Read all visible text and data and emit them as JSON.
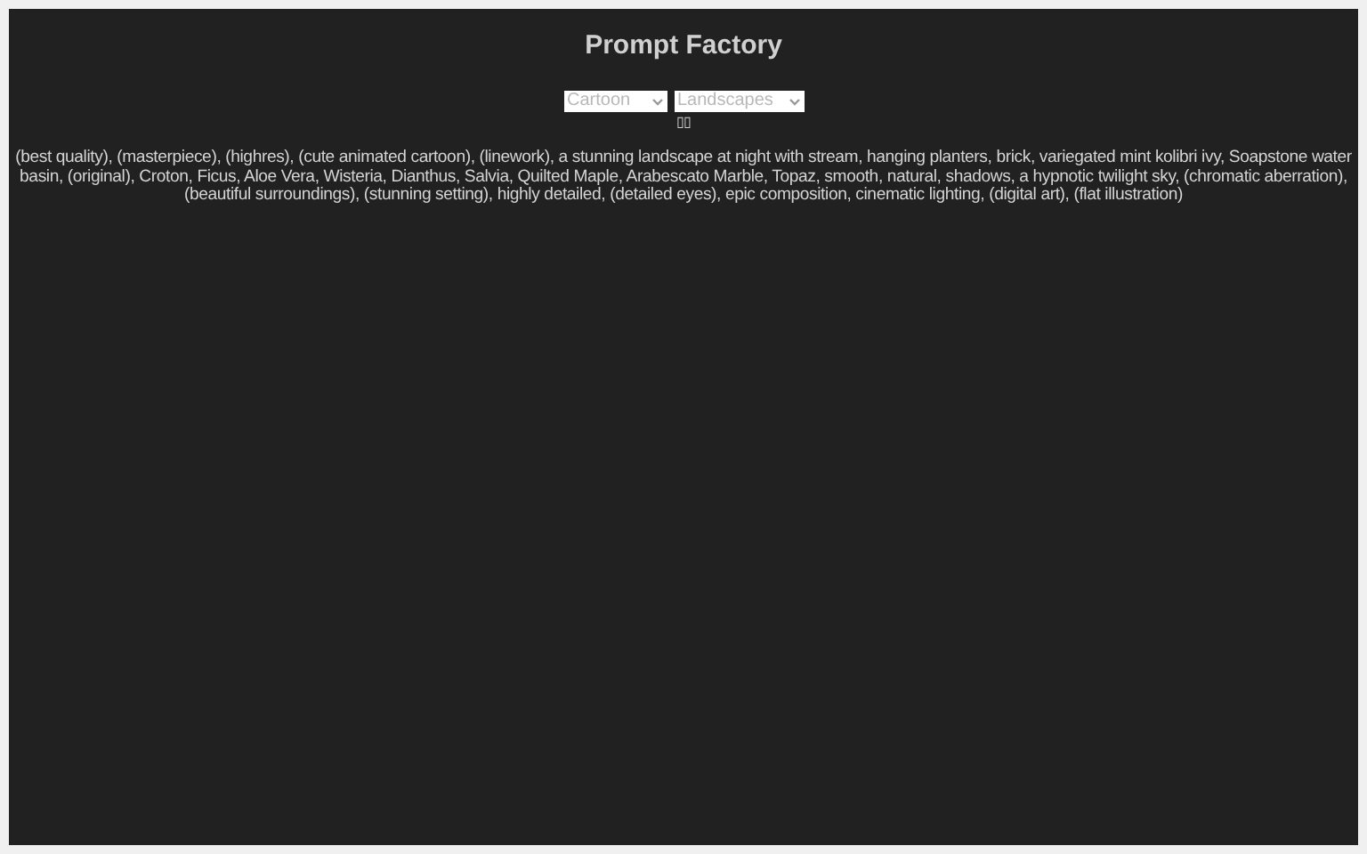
{
  "title": "Prompt Factory",
  "selects": [
    {
      "value": "Cartoon"
    },
    {
      "value": "Landscapes"
    }
  ],
  "generate_button": "▯▯",
  "prompt": "(best quality), (masterpiece), (highres), (cute animated cartoon), (linework), a stunning landscape at night with stream, hanging planters, brick, variegated mint kolibri ivy, Soapstone water basin, (original), Croton, Ficus, Aloe Vera, Wisteria, Dianthus, Salvia, Quilted Maple, Arabescato Marble, Topaz, smooth, natural, shadows, a hypnotic twilight sky, (chromatic aberration), (beautiful surroundings), (stunning setting), highly detailed, (detailed eyes), epic composition, cinematic lighting, (digital art), (flat illustration)"
}
